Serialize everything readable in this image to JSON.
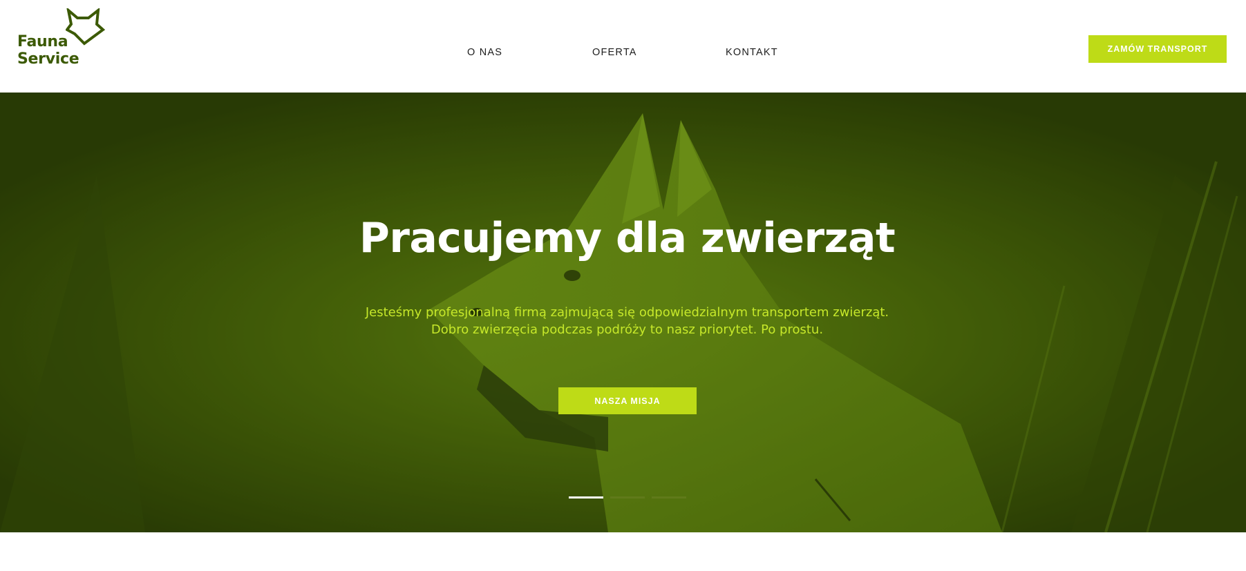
{
  "header": {
    "logo": {
      "line1": "Fauna",
      "line2": "Service",
      "icon": "fox-head-icon",
      "color": "#3c5a05"
    },
    "nav": [
      {
        "label": "O NAS"
      },
      {
        "label": "OFERTA"
      },
      {
        "label": "KONTAKT"
      }
    ],
    "cta_label": "ZAMÓW TRANSPORT"
  },
  "hero": {
    "title": "Pracujemy dla zwierząt",
    "subtitle_line1": "Jesteśmy profesjonalną firmą zajmującą się odpowiedzialnym transportem zwierząt.",
    "subtitle_line2": "Dobro zwierzęcia podczas podróży to nasz priorytet. Po prostu.",
    "cta_label": "NASZA MISJA",
    "slides_total": 3,
    "active_slide": 1
  },
  "colors": {
    "accent": "#bedb17",
    "brand_dark": "#3c5a05",
    "hero_overlay": "#4c6a08",
    "subtitle": "#c6e82a"
  }
}
